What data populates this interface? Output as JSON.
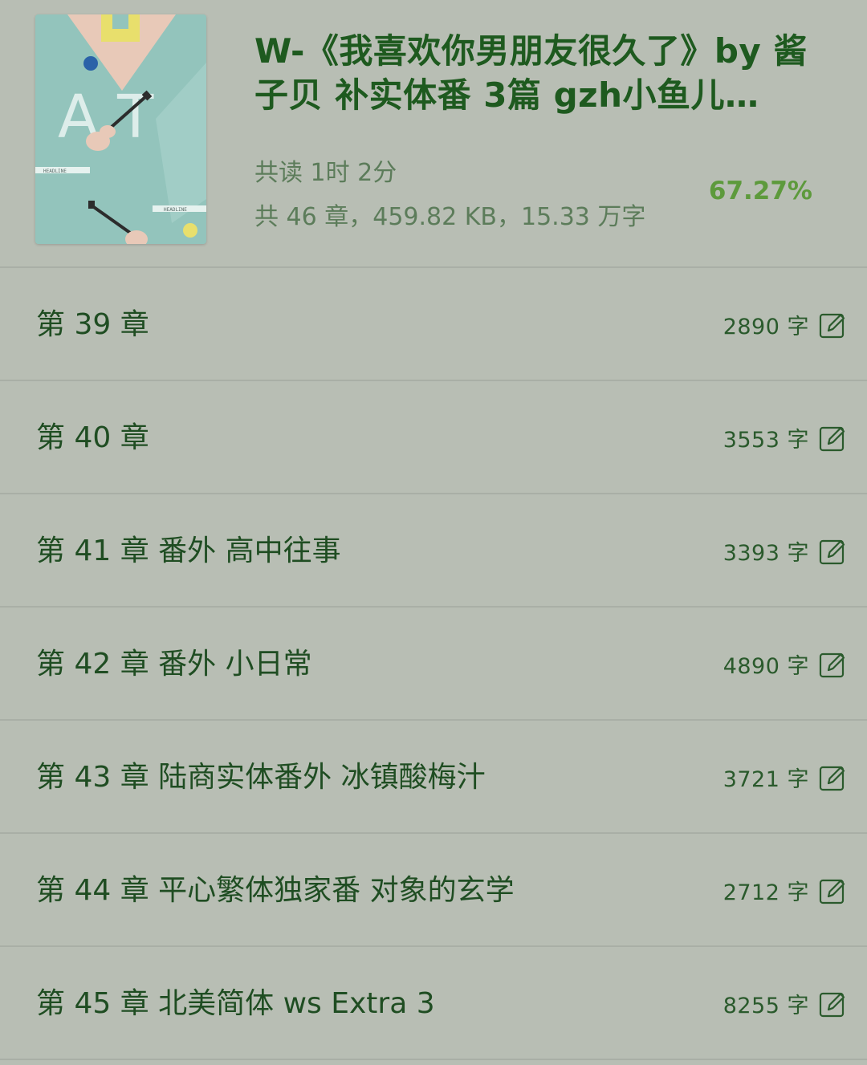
{
  "book": {
    "title": "W-《我喜欢你男朋友很久了》by 酱子贝 补实体番 3篇 gzh小鱼儿…",
    "read_time": "共读 1时 2分",
    "stats": "共 46 章，459.82 KB，15.33 万字",
    "progress": "67.27%",
    "cover_letters": "A T",
    "cover_tag_1": "HEADLINE",
    "cover_tag_2": "HEADLINE"
  },
  "colors": {
    "background": "#b8beb4",
    "title": "#1e5a1f",
    "progress": "#5d9a3c",
    "divider": "#a9afa6"
  },
  "chapters": [
    {
      "title": "第 39 章",
      "words": "2890 字",
      "icon": "edit-icon"
    },
    {
      "title": "第 40 章",
      "words": "3553 字",
      "icon": "edit-icon"
    },
    {
      "title": "第 41 章 番外 高中往事",
      "words": "3393 字",
      "icon": "edit-icon"
    },
    {
      "title": "第 42 章 番外 小日常",
      "words": "4890 字",
      "icon": "edit-icon"
    },
    {
      "title": "第 43 章 陆商实体番外 冰镇酸梅汁",
      "words": "3721 字",
      "icon": "edit-icon"
    },
    {
      "title": "第 44 章 平心繁体独家番 对象的玄学",
      "words": "2712 字",
      "icon": "edit-icon"
    },
    {
      "title": "第 45 章 北美简体 ws Extra 3",
      "words": "8255 字",
      "icon": "edit-icon"
    }
  ]
}
